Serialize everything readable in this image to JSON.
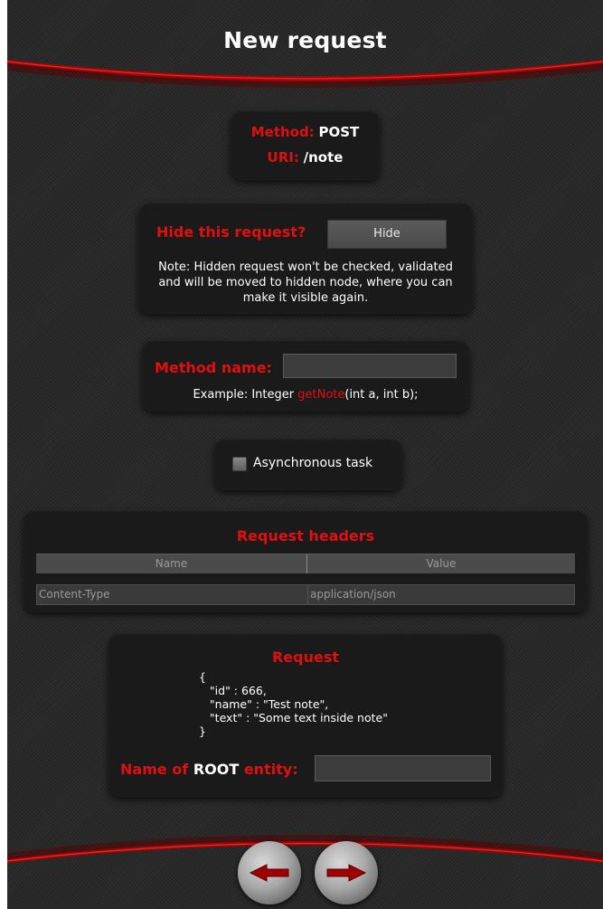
{
  "header": {
    "title": "New request"
  },
  "info": {
    "method_label": "Method:",
    "method_value": "POST",
    "uri_label": "URI:",
    "uri_value": "/note"
  },
  "hide": {
    "question": "Hide this request?",
    "button_label": "Hide",
    "note": "Note: Hidden request won't be checked, validated and will be moved to hidden node, where you can make it visible again."
  },
  "method_name": {
    "label": "Method name:",
    "value": "",
    "example_prefix": "Example: Integer ",
    "example_highlight": "getNote",
    "example_suffix": "(int a, int b);"
  },
  "async": {
    "label": "Asynchronous task",
    "checked": false
  },
  "request_headers": {
    "title": "Request headers",
    "columns": [
      "Name",
      "Value"
    ],
    "rows": [
      {
        "name": "Content-Type",
        "value": "application/json"
      }
    ]
  },
  "request": {
    "title": "Request",
    "body": "{\n   \"id\" : 666,\n   \"name\" : \"Test note\",\n   \"text\" : \"Some text inside note\"\n}",
    "root_label_prefix": "Name of ",
    "root_label_highlight": "ROOT",
    "root_label_suffix": " entity:",
    "root_value": ""
  },
  "navigation": {
    "back_icon": "arrow-left-icon",
    "forward_icon": "arrow-right-icon"
  },
  "colors": {
    "accent": "#e01010",
    "background": "#2a2a2a",
    "panel": "#1a1a1a"
  }
}
